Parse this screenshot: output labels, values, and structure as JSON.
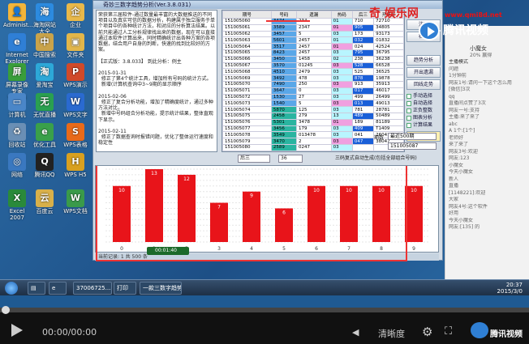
{
  "desktop_icons": [
    {
      "label": "Administ...",
      "color": "#f3b53a",
      "glyph": "👤"
    },
    {
      "label": "海淘网站大全",
      "color": "#2c8be0",
      "glyph": "海"
    },
    {
      "label": "企业",
      "color": "#e8b84a",
      "glyph": "企"
    },
    {
      "label": "Internet Explorer",
      "color": "#2f7fd6",
      "glyph": "e"
    },
    {
      "label": "中国搜索",
      "color": "#c9a34a",
      "glyph": "中"
    },
    {
      "label": "文件夹",
      "color": "#e2b64a",
      "glyph": "▣"
    },
    {
      "label": "屏幕录像专家V2014",
      "color": "#3a9e3a",
      "glyph": "屏"
    },
    {
      "label": "爱淘宝",
      "color": "#2da8d8",
      "glyph": "淘"
    },
    {
      "label": "WPS演示",
      "color": "#d04a2a",
      "glyph": "P"
    },
    {
      "label": "计算机",
      "color": "#4a86c8",
      "glyph": "▭"
    },
    {
      "label": "无忧直播",
      "color": "#2aa050",
      "glyph": "无"
    },
    {
      "label": "WPS文字",
      "color": "#2a6ad0",
      "glyph": "W"
    },
    {
      "label": "回收站",
      "color": "#6a8fb5",
      "glyph": "♻"
    },
    {
      "label": "优化工具",
      "color": "#3aa04a",
      "glyph": "e"
    },
    {
      "label": "WPS表格",
      "color": "#e86a1a",
      "glyph": "S"
    },
    {
      "label": "网络",
      "color": "#3a78c0",
      "glyph": "◎"
    },
    {
      "label": "腾讯QQ",
      "color": "#222",
      "glyph": "Q"
    },
    {
      "label": "WPS H5",
      "color": "#d8a020",
      "glyph": "H"
    },
    {
      "label": "Excel 2007",
      "color": "#2a8a3a",
      "glyph": "X"
    },
    {
      "label": "百度云",
      "color": "#d8b04a",
      "glyph": "云"
    },
    {
      "label": "WPS文档",
      "color": "#3a9a4a",
      "glyph": "W"
    }
  ],
  "app": {
    "title": "奇妙三数字趋势分析(Ver.3.8.031)",
    "text_pane": "荣获第三届软件-通过数量最丰富的大数据推送的不同项目以及真实可信的数据分析，构建属于独立服务于单个项目中的各种统计方法，和对应的分析算法结果。以前只能通过人工分析规律找出来的数据，现在可以直接通过本软件计算出来，同时精确统计出各种方案的各项数据，结合用户自身的判断，快速的找到比较好的方案。\n\n【正式版：3.8.033】 到此分析：例主\n\n2015-01-31\n  修正了第4个统计工具，增加所有号码的统计方式。\n  新增(计算机查询中3~9期的显示顺序\n\n2015-02-06\n  修正了复合分析功能，增加了精确度统计，通过多种方法对比，\n  新增中号码组合分析功能，提示统计结果，整体直观下显示。\n\n2015-02-11\n  修正了数据查询时报错问题，优化了整体运行速度和稳定性",
    "grid_headers": [
      "期号",
      "号码",
      "遗漏",
      "热码",
      "后三",
      "开奖号"
    ],
    "grid_rows": [
      [
        "151005060",
        "3474",
        "234",
        "01",
        "710",
        "72710"
      ],
      [
        "151005061",
        "3589",
        "2347",
        "01",
        "905",
        "34805"
      ],
      [
        "151005062",
        "3457",
        "5",
        "03",
        "173",
        "93173"
      ],
      [
        "151005063",
        "5601",
        "2457",
        "01",
        "032",
        "01832"
      ],
      [
        "151005064",
        "3517",
        "2457",
        "01",
        "024",
        "42524"
      ],
      [
        "151005065",
        "8423",
        "2457",
        "03",
        "795",
        "36795"
      ],
      [
        "151005066",
        "3450",
        "1458",
        "02",
        "238",
        "36238"
      ],
      [
        "151005067",
        "3570",
        "01245",
        "03",
        "528",
        "66528"
      ],
      [
        "151005068",
        "4510",
        "2479",
        "03",
        "525",
        "36525"
      ],
      [
        "151005069",
        "3492",
        "478",
        "03",
        "878",
        "19878"
      ],
      [
        "151005070",
        "7490",
        "250",
        "03",
        "913",
        "35913"
      ],
      [
        "151005071",
        "3647",
        "0",
        "03",
        "017",
        "46017"
      ],
      [
        "151005072",
        "1530",
        "27",
        "03",
        "499",
        "26499"
      ],
      [
        "151005073",
        "1540",
        "5",
        "03",
        "013",
        "49013"
      ],
      [
        "151005074",
        "5870",
        "125",
        "03",
        "781",
        "28781"
      ],
      [
        "151005075",
        "2458",
        "279",
        "13",
        "489",
        "50489"
      ],
      [
        "151005076",
        "5301",
        "3478",
        "01",
        "189",
        "81189"
      ],
      [
        "151005077",
        "3456",
        "179",
        "03",
        "409",
        "T1409"
      ],
      [
        "151005078",
        "3549",
        "013478",
        "03",
        "041",
        "26041"
      ],
      [
        "151005079",
        "3470",
        "2",
        "03",
        "047",
        "38047"
      ],
      [
        "151005080",
        "2589",
        "0247",
        "03",
        "",
        ""
      ]
    ],
    "buttons": {
      "reg": "注册",
      "more": "检验",
      "trend": "趋势分析",
      "open_check": "开出遗漏",
      "line_trend": "回线走势",
      "refresh": "刷新数据"
    },
    "checks": [
      "手动选择",
      "自动选择",
      "正负整数",
      "图表分析",
      "计算结果"
    ],
    "period_label": "期数",
    "period_value": "最近500期",
    "id_value": "151005087",
    "toolbar": {
      "mode": "后三",
      "count": "36",
      "option": "三码复式自动生成(包括全部组合号码)"
    },
    "status": "当前记录: 1  共 500 条"
  },
  "chart_data": {
    "type": "bar",
    "categories": [
      "0",
      "1",
      "2",
      "3",
      "4",
      "5",
      "6",
      "7",
      "8",
      "9"
    ],
    "values": [
      10,
      13,
      12,
      7,
      9,
      6,
      10,
      10,
      10,
      10
    ],
    "ylim": [
      0,
      13
    ],
    "data_labels": [
      "10",
      "13",
      "12",
      "7",
      "9",
      "6",
      "10",
      "10",
      "10",
      "10"
    ],
    "bar_color": "#e8141a"
  },
  "rec_time": "00:01:40",
  "taskbar": {
    "items": [
      "37006725...",
      "打印",
      "一款三数字趋势..."
    ],
    "time": "20:37",
    "date": "2015/3/0"
  },
  "chat": {
    "name": "小魔女",
    "stats": "20% 赢得",
    "mode": "主播模式",
    "lines": [
      "问题",
      "1分钟前",
      "网友1号:请问一下这个怎么用",
      "[微信]3次",
      "qq",
      "直播间点赞了3次",
      "网友一号:支持",
      "主播:来了来了",
      "abc",
      "A 1个:[1个]",
      "老师好",
      "来了来了",
      "网友3号:欢迎",
      "网友:123",
      "小魔女",
      "今天小魔女",
      "新人",
      "直播",
      "[1148221]:欢迎",
      "大家",
      "网友4号:这个软件",
      "好用",
      "今天小魔女",
      "网友:[135] 的",
      ""
    ]
  },
  "watermark": {
    "site": "奇 娱乐网",
    "url": "www.qmi8d.net",
    "brand": "腾讯视频"
  },
  "player": {
    "time": "00:00/00:00",
    "clarity": "清晰度",
    "brand": "腾讯视频"
  }
}
